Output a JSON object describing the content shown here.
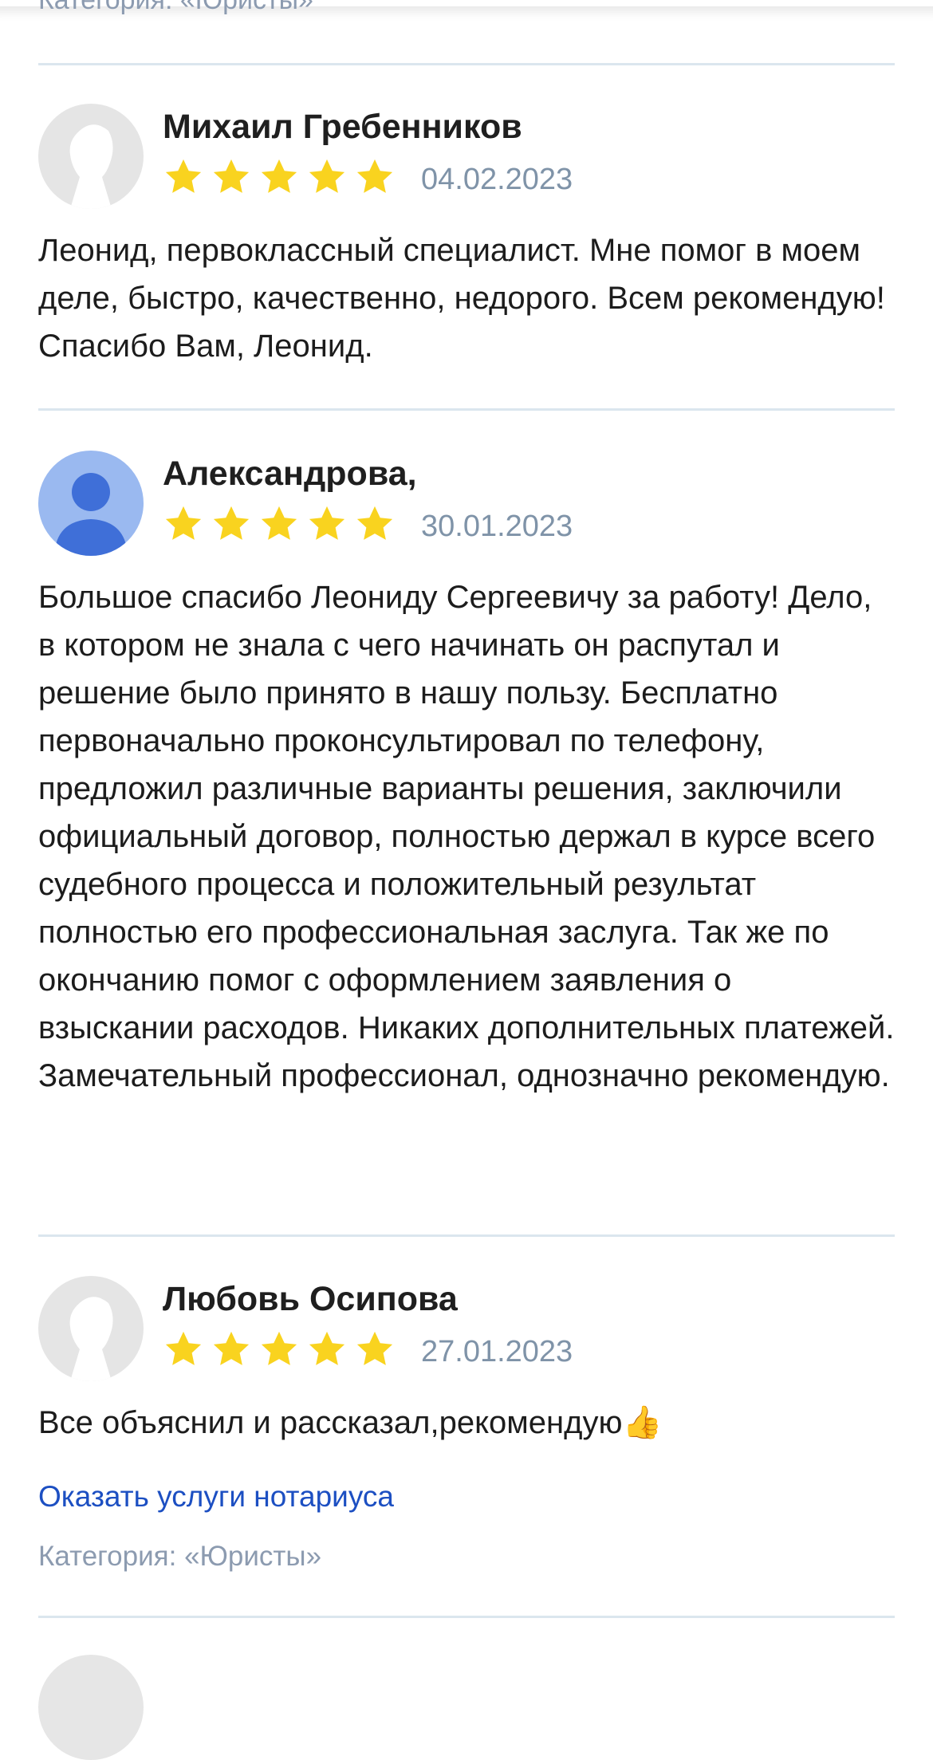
{
  "top": {
    "category": "Категория: «Юристы»"
  },
  "reviews": [
    {
      "author": "Михаил Гребенников",
      "rating": 5,
      "date": "04.02.2023",
      "text": "Леонид, первоклассный специалист. Мне помог в моем деле, быстро, качественно, недорого. Всем рекомендую! Спасибо Вам, Леонид.",
      "avatar": "default-silhouette-avatar"
    },
    {
      "author": "Александрова,",
      "rating": 5,
      "date": "30.01.2023",
      "text": "Большое спасибо Леониду Сергеевичу за работу! Дело, в котором не знала с чего начинать он распутал и решение было принято в нашу пользу. Бесплатно первоначально проконсультировал по телефону, предложил различные варианты решения, заключили официальный договор, полностью держал в курсе всего судебного процесса и положительный результат полностью его профессиональная заслуга. Так же по окончанию помог с оформлением заявления о взыскании расходов. Никаких дополнительных платежей. Замечательный профессионал, однозначно рекомендую.",
      "avatar": "blue-person-avatar"
    },
    {
      "author": "Любовь Осипова",
      "rating": 5,
      "date": "27.01.2023",
      "text": "Все объяснил и рассказал,рекомендую👍",
      "avatar": "default-silhouette-avatar",
      "service_link": "Оказать услуги нотариуса",
      "category": "Категория: «Юристы»"
    }
  ],
  "colors": {
    "star": "#f9d31f",
    "link": "#1c4fc2",
    "muted": "#8c9bb0",
    "divider": "#dbe6ee",
    "avatar_blue_bg": "#9ab9f0",
    "avatar_blue_fg": "#3f6fd8"
  }
}
